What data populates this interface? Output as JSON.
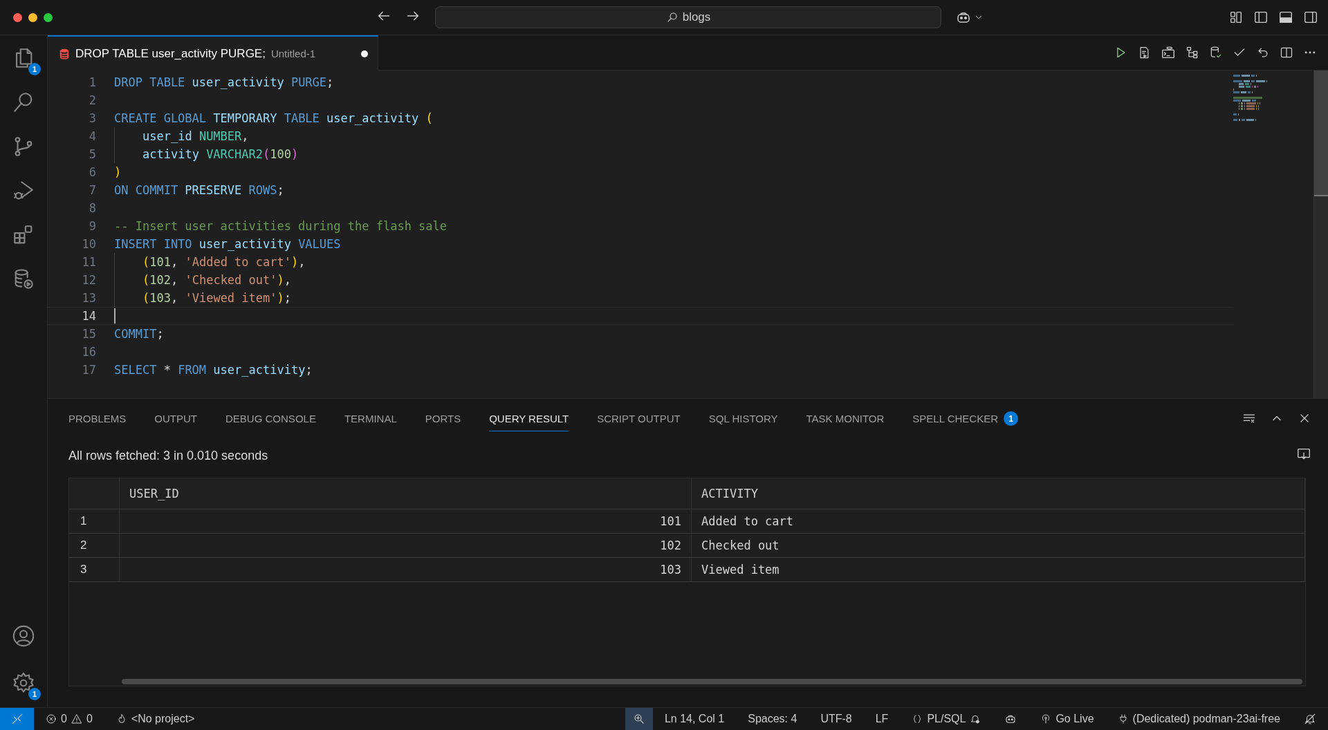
{
  "title_bar": {
    "search": "blogs"
  },
  "activity_bar": {
    "top": [
      {
        "kind": "explorer",
        "badge": "1"
      },
      {
        "kind": "search"
      },
      {
        "kind": "source-control"
      },
      {
        "kind": "run-debug"
      },
      {
        "kind": "extensions"
      },
      {
        "kind": "database"
      }
    ],
    "bottom": [
      {
        "kind": "account"
      },
      {
        "kind": "settings",
        "badge": "1"
      }
    ]
  },
  "editor_tab": {
    "title": "DROP TABLE user_activity PURGE;",
    "description": "Untitled-1",
    "modified": true
  },
  "editor": {
    "lines": [
      {
        "number": "1",
        "current": false,
        "indented": false,
        "tokens": [
          {
            "kind": "kw",
            "text": "DROP TABLE "
          },
          {
            "kind": "ident",
            "text": "user_activity "
          },
          {
            "kind": "kw",
            "text": "PURGE"
          },
          {
            "kind": "punc",
            "text": ";"
          }
        ]
      },
      {
        "number": "2",
        "current": false,
        "indented": false
      },
      {
        "number": "3",
        "current": false,
        "indented": false,
        "tokens": [
          {
            "kind": "kw",
            "text": "CREATE GLOBAL "
          },
          {
            "kind": "ident",
            "text": "TEMPORARY "
          },
          {
            "kind": "kw",
            "text": "TABLE "
          },
          {
            "kind": "ident",
            "text": "user_activity "
          },
          {
            "kind": "bracket",
            "text": "("
          }
        ]
      },
      {
        "number": "4",
        "current": false,
        "indented": true,
        "tokens": [
          {
            "kind": "ident",
            "text": "user_id "
          },
          {
            "kind": "type",
            "text": "NUMBER"
          },
          {
            "kind": "punc",
            "text": ","
          }
        ]
      },
      {
        "number": "5",
        "current": false,
        "indented": true,
        "tokens": [
          {
            "kind": "ident",
            "text": "activity "
          },
          {
            "kind": "type",
            "text": "VARCHAR2"
          },
          {
            "kind": "paren",
            "text": "("
          },
          {
            "kind": "num",
            "text": "100"
          },
          {
            "kind": "paren",
            "text": ")"
          }
        ]
      },
      {
        "number": "6",
        "current": false,
        "indented": false,
        "tokens": [
          {
            "kind": "bracket",
            "text": ")"
          }
        ]
      },
      {
        "number": "7",
        "current": false,
        "indented": false,
        "tokens": [
          {
            "kind": "kw",
            "text": "ON COMMIT "
          },
          {
            "kind": "ident",
            "text": "PRESERVE "
          },
          {
            "kind": "kw",
            "text": "ROWS"
          },
          {
            "kind": "punc",
            "text": ";"
          }
        ]
      },
      {
        "number": "8",
        "current": false,
        "indented": false
      },
      {
        "number": "9",
        "current": false,
        "indented": false,
        "tokens": [
          {
            "kind": "comment",
            "text": "-- Insert user activities during the flash sale"
          }
        ]
      },
      {
        "number": "10",
        "current": false,
        "indented": false,
        "tokens": [
          {
            "kind": "kw",
            "text": "INSERT INTO "
          },
          {
            "kind": "ident",
            "text": "user_activity "
          },
          {
            "kind": "kw",
            "text": "VALUES"
          }
        ]
      },
      {
        "number": "11",
        "current": false,
        "indented": true,
        "tokens": [
          {
            "kind": "bracket",
            "text": "("
          },
          {
            "kind": "num",
            "text": "101"
          },
          {
            "kind": "punc",
            "text": ", "
          },
          {
            "kind": "str",
            "text": "'Added to cart'"
          },
          {
            "kind": "bracket",
            "text": ")"
          },
          {
            "kind": "punc",
            "text": ","
          }
        ]
      },
      {
        "number": "12",
        "current": false,
        "indented": true,
        "tokens": [
          {
            "kind": "bracket",
            "text": "("
          },
          {
            "kind": "num",
            "text": "102"
          },
          {
            "kind": "punc",
            "text": ", "
          },
          {
            "kind": "str",
            "text": "'Checked out'"
          },
          {
            "kind": "bracket",
            "text": ")"
          },
          {
            "kind": "punc",
            "text": ","
          }
        ]
      },
      {
        "number": "13",
        "current": false,
        "indented": true,
        "tokens": [
          {
            "kind": "bracket",
            "text": "("
          },
          {
            "kind": "num",
            "text": "103"
          },
          {
            "kind": "punc",
            "text": ", "
          },
          {
            "kind": "str",
            "text": "'Viewed item'"
          },
          {
            "kind": "bracket",
            "text": ")"
          },
          {
            "kind": "punc",
            "text": ";"
          }
        ]
      },
      {
        "number": "14",
        "current": true,
        "indented": false
      },
      {
        "number": "15",
        "current": false,
        "indented": false,
        "tokens": [
          {
            "kind": "kw",
            "text": "COMMIT"
          },
          {
            "kind": "punc",
            "text": ";"
          }
        ]
      },
      {
        "number": "16",
        "current": false,
        "indented": false
      },
      {
        "number": "17",
        "current": false,
        "indented": false,
        "tokens": [
          {
            "kind": "kw",
            "text": "SELECT "
          },
          {
            "kind": "punc",
            "text": "* "
          },
          {
            "kind": "kw",
            "text": "FROM "
          },
          {
            "kind": "ident",
            "text": "user_activity"
          },
          {
            "kind": "punc",
            "text": ";"
          }
        ]
      }
    ]
  },
  "panel": {
    "tabs": [
      {
        "label": "PROBLEMS",
        "selected": false
      },
      {
        "label": "OUTPUT",
        "selected": false
      },
      {
        "label": "DEBUG CONSOLE",
        "selected": false
      },
      {
        "label": "TERMINAL",
        "selected": false
      },
      {
        "label": "PORTS",
        "selected": false
      },
      {
        "label": "QUERY RESULT",
        "selected": true
      },
      {
        "label": "SCRIPT OUTPUT",
        "selected": false
      },
      {
        "label": "SQL HISTORY",
        "selected": false
      },
      {
        "label": "TASK MONITOR",
        "selected": false
      },
      {
        "label": "SPELL CHECKER",
        "selected": false,
        "badge": "1"
      }
    ],
    "message": "All rows fetched: 3 in 0.010 seconds",
    "table": {
      "columns": [
        "USER_ID",
        "ACTIVITY"
      ],
      "rows": [
        {
          "index": "1",
          "cells": [
            "101",
            "Added to cart"
          ]
        },
        {
          "index": "2",
          "cells": [
            "102",
            "Checked out"
          ]
        },
        {
          "index": "3",
          "cells": [
            "103",
            "Viewed item"
          ]
        }
      ]
    }
  },
  "status_bar": {
    "items": [
      {
        "kind": "remote"
      },
      {
        "kind": "problems",
        "errors": "0",
        "warnings": "0"
      },
      {
        "kind": "project",
        "text": "<No project>"
      },
      {
        "kind": "zoom"
      },
      {
        "kind": "text",
        "text": "Ln 14, Col 1"
      },
      {
        "kind": "text",
        "text": "Spaces: 4"
      },
      {
        "kind": "text",
        "text": "UTF-8"
      },
      {
        "kind": "text",
        "text": "LF"
      },
      {
        "kind": "language",
        "text": "PL/SQL"
      },
      {
        "kind": "copilot"
      },
      {
        "kind": "golive",
        "text": "Go Live"
      },
      {
        "kind": "connection",
        "text": "(Dedicated) podman-23ai-free"
      },
      {
        "kind": "notifications"
      }
    ]
  }
}
